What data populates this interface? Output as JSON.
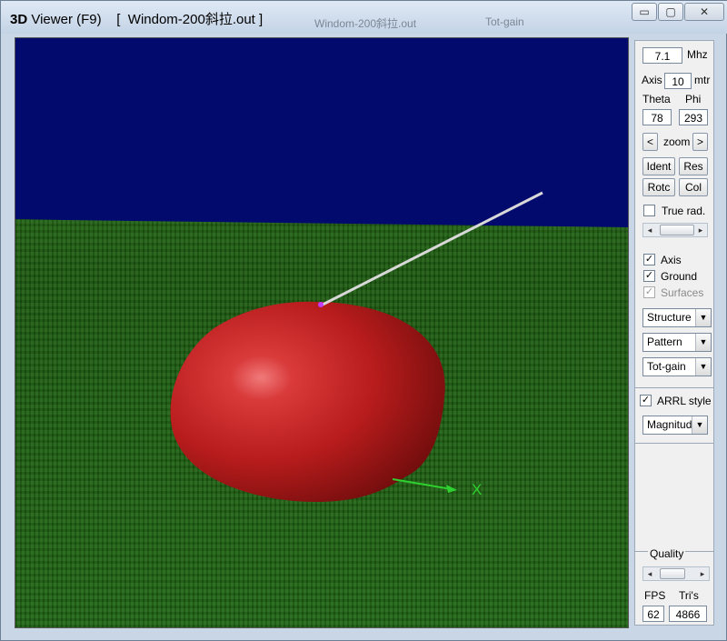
{
  "window": {
    "title_bold": "3D",
    "title": " Viewer (F9)",
    "file": "[  Windom-200斜拉.out ]",
    "ghost_left": "Windom-200斜拉.out",
    "ghost_right": "Tot-gain",
    "controls": {
      "minimize": "▭",
      "maximize": "▢",
      "close": "✕"
    }
  },
  "panel": {
    "freq_value": "7.1",
    "freq_unit": "Mhz",
    "axis_label": "Axis",
    "axis_value": "10",
    "axis_unit": "mtr",
    "theta_label": "Theta",
    "phi_label": "Phi",
    "theta_value": "78",
    "phi_value": "293",
    "zoom_left": "<",
    "zoom_label": "zoom",
    "zoom_right": ">",
    "ident": "Ident",
    "res": "Res",
    "rotc": "Rotc",
    "col": "Col",
    "true_rad": "True rad.",
    "axis_check": "Axis",
    "ground_check": "Ground",
    "surfaces_check": "Surfaces",
    "checkmark": "✓",
    "select_structure": "Structure",
    "select_pattern": "Pattern",
    "select_gain": "Tot-gain",
    "arrl_style": "ARRL style",
    "select_magnitude": "Magnitude",
    "quality": "Quality",
    "fps_label": "FPS",
    "tris_label": "Tri's",
    "fps_value": "62",
    "tris_value": "4866",
    "arrow_left": "◂",
    "arrow_right": "▸",
    "arrow_down": "▼"
  },
  "scene": {
    "axis_x_label": "X",
    "sky_color": "#020a6e",
    "ground_color": "#1f6614",
    "pattern_color": "#c81e1e"
  }
}
